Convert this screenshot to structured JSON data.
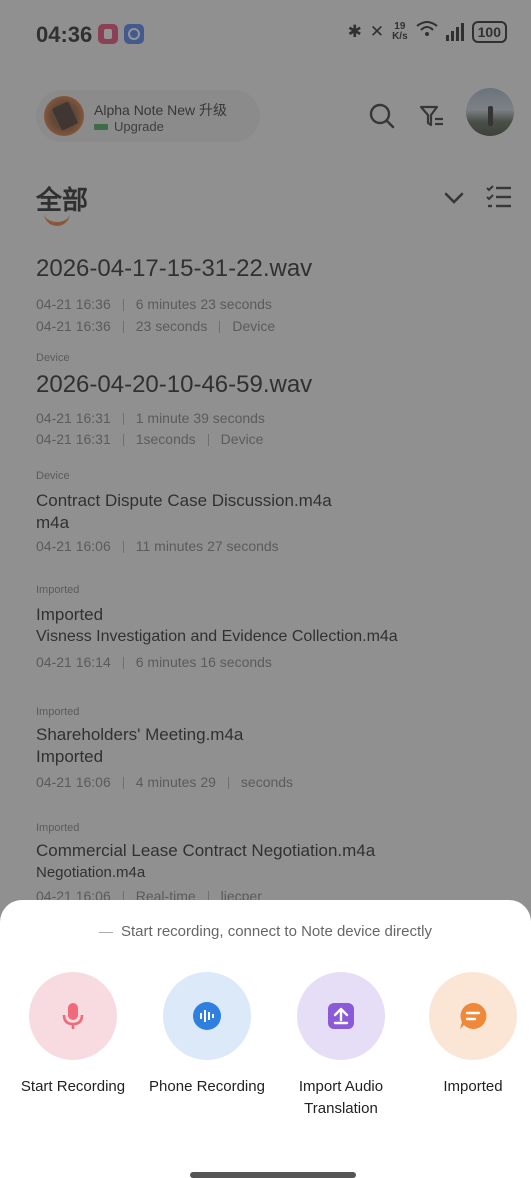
{
  "status_bar": {
    "time": "04:36",
    "net_speed_value": "19",
    "net_speed_unit": "K/s",
    "battery": "100"
  },
  "header": {
    "account_name": "Alpha Note New 升级",
    "account_sub": "Upgrade"
  },
  "section": {
    "title": "全部"
  },
  "list": {
    "items": [
      {
        "tag": "",
        "name_line1": "2026-04-17-15-31-22.wav",
        "name_line2": "",
        "meta1_a": "04-21 16:36",
        "meta1_b": "6 minutes 23 seconds",
        "meta1_c": "",
        "meta2_a": "04-21 16:36",
        "meta2_b": "23 seconds",
        "meta2_c": "Device"
      },
      {
        "tag": "Device",
        "name_line1": "2026-04-20-10-46-59.wav",
        "name_line2": "",
        "meta1_a": "04-21 16:31",
        "meta1_b": "1 minute 39 seconds",
        "meta1_c": "",
        "meta2_a": "04-21 16:31",
        "meta2_b": "1seconds",
        "meta2_c": "Device"
      },
      {
        "tag": "Device",
        "name_line1": "Contract Dispute Case Discussion.m4a",
        "name_line2": "m4a",
        "meta1_a": "04-21 16:06",
        "meta1_b": "11 minutes 27 seconds",
        "meta1_c": ""
      },
      {
        "tag": "Imported",
        "name_line1": "Imported",
        "name_line2": "Visness Investigation and Evidence Collection.m4a",
        "meta1_a": "04-21 16:14",
        "meta1_b": "6 minutes  16  seconds",
        "meta1_c": ""
      },
      {
        "tag": "Imported",
        "name_line1": "Shareholders' Meeting.m4a",
        "name_line2": "Imported",
        "meta1_a": "04-21 16:06",
        "meta1_b": "4 minutes 29",
        "meta1_c": "seconds"
      },
      {
        "tag": "Imported",
        "name_line1": "Commercial Lease Contract Negotiation.m4a",
        "name_line2": "Negotiation.m4a",
        "meta1_a": "04-21 16:06",
        "meta1_b": "Real-time",
        "meta1_c": "liecper"
      }
    ]
  },
  "sheet": {
    "hint": "Start recording, connect to Note device directly",
    "actions": [
      {
        "label": "Start Recording",
        "icon": "microphone-icon",
        "color": "#f7dbe0",
        "accent": "#f06a7a"
      },
      {
        "label": "Phone Recording",
        "icon": "audio-wave-icon",
        "color": "#dbe9f8",
        "accent": "#2f7fe0"
      },
      {
        "label": "Import Audio Translation",
        "icon": "upload-icon",
        "color": "#e6def7",
        "accent": "#8b5ad8"
      },
      {
        "label": "Imported",
        "icon": "chat-bubble-icon",
        "color": "#fbe6d6",
        "accent": "#f0883a"
      }
    ]
  }
}
